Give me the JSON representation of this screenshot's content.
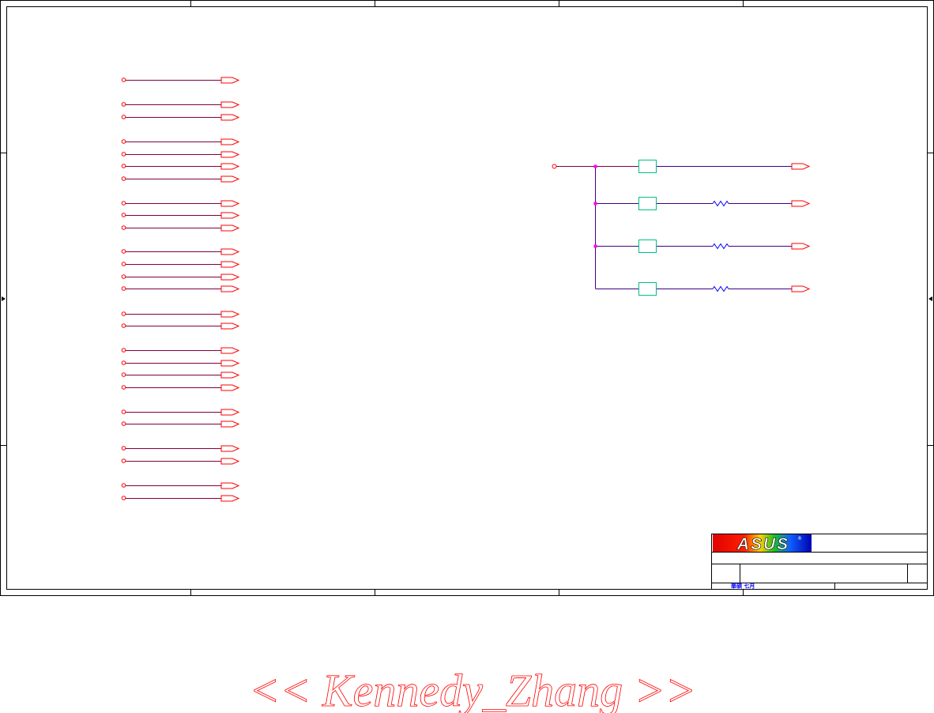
{
  "sheet": {
    "title_block": {
      "logo_text": "ASUS",
      "registered_mark": "®",
      "footer_text": "華碩 七月"
    }
  },
  "watermark": {
    "text": "<< Kennedy_Zhang >>"
  },
  "colors": {
    "frame": "#000000",
    "wire": "#800040",
    "wire_right": "#400080",
    "port": "#ff0000",
    "junction": "#ff00ff",
    "ferrite": "#00c080",
    "resistor": "#0000ff",
    "watermark": "#ff0000"
  },
  "icons": [
    "asus-logo-icon",
    "port-connector-icon",
    "resistor-icon",
    "ferrite-bead-icon"
  ]
}
